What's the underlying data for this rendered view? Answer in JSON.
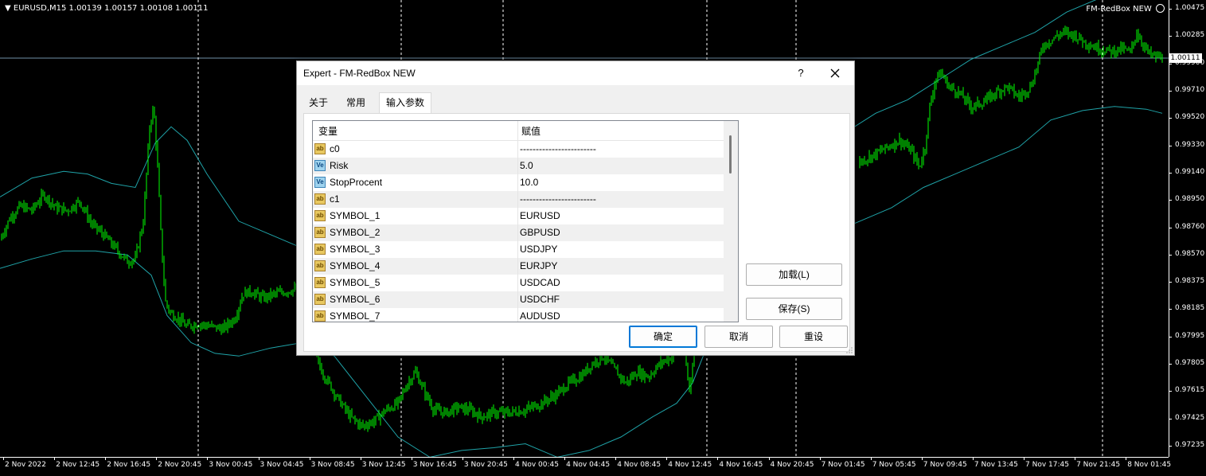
{
  "window": {
    "symbol_info": "EURUSD,M15  1.00139 1.00157 1.00108 1.00111",
    "ea_name": "FM-RedBox NEW"
  },
  "colors": {
    "background": "#000000",
    "candle": "#00ff00",
    "bands": "#1fa3a8",
    "grid": "#ffffff",
    "dialog_accent": "#0078d7"
  },
  "price_scale": {
    "labels": [
      "1.00475",
      "1.00285",
      "0.99900",
      "0.99710",
      "0.99520",
      "0.99330",
      "0.99140",
      "0.98950",
      "0.98760",
      "0.98570",
      "0.98375",
      "0.98185",
      "0.97995",
      "0.97805",
      "0.97615",
      "0.97425",
      "0.97235"
    ],
    "current": "1.00111"
  },
  "time_scale": {
    "labels": [
      "2 Nov 2022",
      "2 Nov 12:45",
      "2 Nov 16:45",
      "2 Nov 20:45",
      "3 Nov 00:45",
      "3 Nov 04:45",
      "3 Nov 08:45",
      "3 Nov 12:45",
      "3 Nov 16:45",
      "3 Nov 20:45",
      "4 Nov 00:45",
      "4 Nov 04:45",
      "4 Nov 08:45",
      "4 Nov 12:45",
      "4 Nov 16:45",
      "4 Nov 20:45",
      "7 Nov 01:45",
      "7 Nov 05:45",
      "7 Nov 09:45",
      "7 Nov 13:45",
      "7 Nov 17:45",
      "7 Nov 21:45",
      "8 Nov 01:45"
    ]
  },
  "chart_data": {
    "type": "candlestick",
    "symbol": "EURUSD",
    "timeframe": "M15",
    "ylim": [
      0.97235,
      1.00475
    ],
    "current_price": 1.00111,
    "close_path": [
      [
        0,
        0.9876
      ],
      [
        12,
        0.9892
      ],
      [
        25,
        0.9901
      ],
      [
        40,
        0.9898
      ],
      [
        55,
        0.991
      ],
      [
        70,
        0.99
      ],
      [
        85,
        0.9898
      ],
      [
        100,
        0.9905
      ],
      [
        115,
        0.9888
      ],
      [
        130,
        0.988
      ],
      [
        145,
        0.987
      ],
      [
        160,
        0.986
      ],
      [
        170,
        0.9862
      ],
      [
        180,
        0.989
      ],
      [
        188,
        0.996
      ],
      [
        193,
        0.9975
      ],
      [
        198,
        0.993
      ],
      [
        203,
        0.987
      ],
      [
        208,
        0.983
      ],
      [
        214,
        0.9822
      ],
      [
        224,
        0.9818
      ],
      [
        234,
        0.9812
      ],
      [
        250,
        0.9814
      ],
      [
        265,
        0.9812
      ],
      [
        280,
        0.981
      ],
      [
        295,
        0.9818
      ],
      [
        305,
        0.9836
      ],
      [
        315,
        0.9838
      ],
      [
        330,
        0.9833
      ],
      [
        345,
        0.9836
      ],
      [
        360,
        0.9838
      ],
      [
        375,
        0.984
      ],
      [
        385,
        0.983
      ],
      [
        395,
        0.9792
      ],
      [
        405,
        0.9778
      ],
      [
        415,
        0.9768
      ],
      [
        425,
        0.9758
      ],
      [
        440,
        0.9745
      ],
      [
        455,
        0.9738
      ],
      [
        470,
        0.9742
      ],
      [
        485,
        0.975
      ],
      [
        500,
        0.9755
      ],
      [
        512,
        0.977
      ],
      [
        522,
        0.9778
      ],
      [
        532,
        0.9765
      ],
      [
        545,
        0.975
      ],
      [
        560,
        0.9748
      ],
      [
        575,
        0.9752
      ],
      [
        590,
        0.975
      ],
      [
        605,
        0.9745
      ],
      [
        620,
        0.9748
      ],
      [
        640,
        0.9748
      ],
      [
        660,
        0.975
      ],
      [
        680,
        0.9755
      ],
      [
        700,
        0.9762
      ],
      [
        715,
        0.977
      ],
      [
        730,
        0.9775
      ],
      [
        745,
        0.9785
      ],
      [
        758,
        0.979
      ],
      [
        772,
        0.978
      ],
      [
        786,
        0.977
      ],
      [
        800,
        0.9778
      ],
      [
        815,
        0.9775
      ],
      [
        830,
        0.9785
      ],
      [
        845,
        0.979
      ],
      [
        858,
        0.98
      ],
      [
        866,
        0.9765
      ],
      [
        873,
        0.98
      ],
      [
        1080,
        0.9934
      ],
      [
        1100,
        0.994
      ],
      [
        1115,
        0.9945
      ],
      [
        1130,
        0.995
      ],
      [
        1145,
        0.9942
      ],
      [
        1155,
        0.993
      ],
      [
        1162,
        0.9945
      ],
      [
        1168,
        0.9975
      ],
      [
        1175,
        0.9995
      ],
      [
        1182,
        1.0
      ],
      [
        1192,
        0.999
      ],
      [
        1205,
        0.9985
      ],
      [
        1220,
        0.9975
      ],
      [
        1235,
        0.9978
      ],
      [
        1250,
        0.9985
      ],
      [
        1265,
        0.999
      ],
      [
        1280,
        0.9982
      ],
      [
        1295,
        0.999
      ],
      [
        1303,
        1.0005
      ],
      [
        1310,
        1.002
      ],
      [
        1322,
        1.0025
      ],
      [
        1335,
        1.003
      ],
      [
        1350,
        1.0028
      ],
      [
        1365,
        1.0022
      ],
      [
        1380,
        1.0018
      ],
      [
        1395,
        1.0016
      ],
      [
        1410,
        1.0018
      ],
      [
        1420,
        1.0015
      ],
      [
        1428,
        1.003
      ],
      [
        1435,
        1.0022
      ],
      [
        1445,
        1.0013
      ],
      [
        1460,
        1.0011
      ]
    ],
    "upper_band_path": [
      [
        0,
        0.9908
      ],
      [
        40,
        0.9922
      ],
      [
        80,
        0.9927
      ],
      [
        110,
        0.9925
      ],
      [
        140,
        0.9918
      ],
      [
        170,
        0.9915
      ],
      [
        195,
        0.9948
      ],
      [
        215,
        0.996
      ],
      [
        235,
        0.995
      ],
      [
        260,
        0.9925
      ],
      [
        300,
        0.989
      ],
      [
        340,
        0.988
      ],
      [
        380,
        0.987
      ],
      [
        420,
        0.9865
      ],
      [
        460,
        0.986
      ],
      [
        500,
        0.986
      ],
      [
        540,
        0.985
      ],
      [
        580,
        0.984
      ],
      [
        620,
        0.983
      ],
      [
        660,
        0.983
      ],
      [
        700,
        0.982
      ],
      [
        740,
        0.981
      ],
      [
        780,
        0.9818
      ],
      [
        820,
        0.983
      ],
      [
        860,
        0.984
      ],
      [
        900,
        0.986
      ],
      [
        940,
        0.988
      ],
      [
        980,
        0.99
      ],
      [
        1020,
        0.9925
      ],
      [
        1060,
        0.9955
      ],
      [
        1100,
        0.997
      ],
      [
        1140,
        0.998
      ],
      [
        1180,
        0.9995
      ],
      [
        1220,
        1.001
      ],
      [
        1260,
        1.002
      ],
      [
        1300,
        1.003
      ],
      [
        1340,
        1.0045
      ],
      [
        1380,
        1.0055
      ],
      [
        1420,
        1.0062
      ],
      [
        1460,
        1.006
      ]
    ],
    "lower_band_path": [
      [
        0,
        0.9855
      ],
      [
        40,
        0.9862
      ],
      [
        80,
        0.9868
      ],
      [
        120,
        0.9868
      ],
      [
        160,
        0.9865
      ],
      [
        190,
        0.985
      ],
      [
        210,
        0.982
      ],
      [
        240,
        0.98
      ],
      [
        270,
        0.9792
      ],
      [
        300,
        0.979
      ],
      [
        340,
        0.9796
      ],
      [
        380,
        0.98
      ],
      [
        420,
        0.979
      ],
      [
        460,
        0.976
      ],
      [
        500,
        0.973
      ],
      [
        540,
        0.9715
      ],
      [
        580,
        0.972
      ],
      [
        620,
        0.9722
      ],
      [
        660,
        0.9725
      ],
      [
        700,
        0.9715
      ],
      [
        740,
        0.972
      ],
      [
        780,
        0.973
      ],
      [
        820,
        0.9745
      ],
      [
        850,
        0.9755
      ],
      [
        870,
        0.977
      ],
      [
        890,
        0.98
      ],
      [
        920,
        0.983
      ],
      [
        960,
        0.985
      ],
      [
        1000,
        0.987
      ],
      [
        1040,
        0.988
      ],
      [
        1080,
        0.989
      ],
      [
        1120,
        0.99
      ],
      [
        1160,
        0.9915
      ],
      [
        1200,
        0.9925
      ],
      [
        1240,
        0.9935
      ],
      [
        1280,
        0.9945
      ],
      [
        1320,
        0.9965
      ],
      [
        1360,
        0.9972
      ],
      [
        1400,
        0.9975
      ],
      [
        1440,
        0.9973
      ],
      [
        1460,
        0.997
      ]
    ],
    "vertical_gridlines_x": [
      249,
      504,
      632,
      888,
      1000,
      1385
    ],
    "grid": "dashed"
  },
  "dialog": {
    "title": "Expert - FM-RedBox NEW",
    "help": "?",
    "tabs": [
      {
        "label": "关于"
      },
      {
        "label": "常用"
      },
      {
        "label": "输入参数",
        "active": true
      }
    ],
    "table": {
      "col_variable": "变量",
      "col_value": "赋值",
      "rows": [
        {
          "type": "ab",
          "icon_text": "ab",
          "name": "c0",
          "value": "------------------------"
        },
        {
          "type": "ve",
          "icon_text": "Ve",
          "name": "Risk",
          "value": "5.0"
        },
        {
          "type": "ve",
          "icon_text": "Ve",
          "name": "StopProcent",
          "value": "10.0"
        },
        {
          "type": "ab",
          "icon_text": "ab",
          "name": "c1",
          "value": "------------------------"
        },
        {
          "type": "ab",
          "icon_text": "ab",
          "name": "SYMBOL_1",
          "value": "EURUSD"
        },
        {
          "type": "ab",
          "icon_text": "ab",
          "name": "SYMBOL_2",
          "value": "GBPUSD"
        },
        {
          "type": "ab",
          "icon_text": "ab",
          "name": "SYMBOL_3",
          "value": "USDJPY"
        },
        {
          "type": "ab",
          "icon_text": "ab",
          "name": "SYMBOL_4",
          "value": "EURJPY"
        },
        {
          "type": "ab",
          "icon_text": "ab",
          "name": "SYMBOL_5",
          "value": "USDCAD"
        },
        {
          "type": "ab",
          "icon_text": "ab",
          "name": "SYMBOL_6",
          "value": "USDCHF"
        },
        {
          "type": "ab",
          "icon_text": "ab",
          "name": "SYMBOL_7",
          "value": "AUDUSD"
        }
      ]
    },
    "buttons": {
      "load": "加载(L)",
      "save": "保存(S)",
      "ok": "确定",
      "cancel": "取消",
      "reset": "重设"
    }
  }
}
